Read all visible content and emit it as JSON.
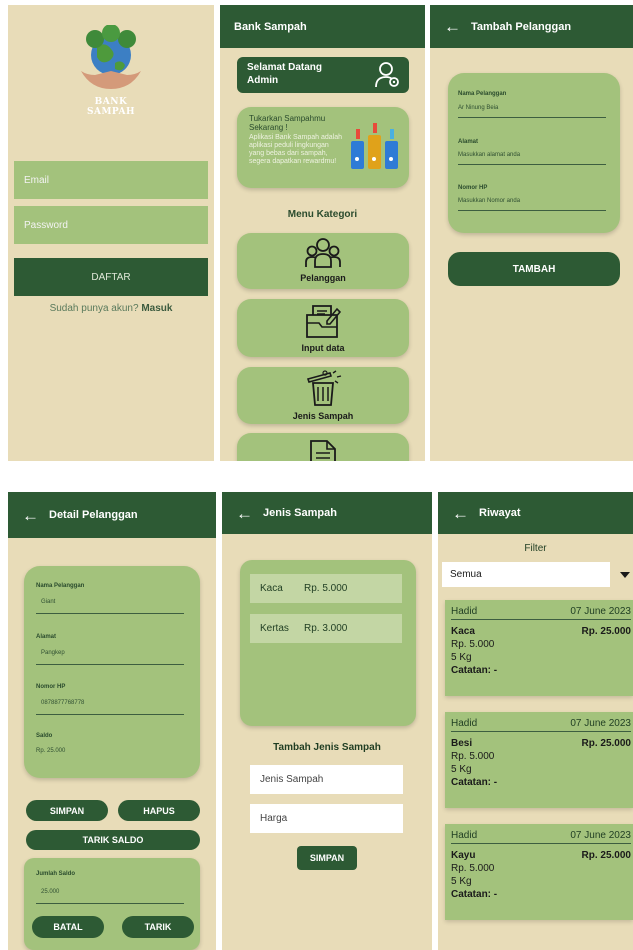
{
  "login": {
    "logo_text": "BANK SAMPAH",
    "email_placeholder": "Email",
    "password_placeholder": "Password",
    "button": "DAFTAR",
    "prompt": "Sudah punya akun?",
    "link": "Masuk"
  },
  "dashboard": {
    "appbar_title": "Bank Sampah",
    "welcome_line1": "Selamat Datang",
    "welcome_line2": "Admin",
    "promo_title": "Tukarkan Sampahmu Sekarang !",
    "promo_body": "Aplikasi Bank Sampah adalah aplikasi peduli lingkungan yang bebas dari sampah, segera dapatkan rewardmu!",
    "menu_heading": "Menu Kategori",
    "menu": [
      {
        "label": "Pelanggan",
        "icon": "users-icon"
      },
      {
        "label": "Input data",
        "icon": "input-folder-icon"
      },
      {
        "label": "Jenis Sampah",
        "icon": "trash-bin-icon"
      },
      {
        "label": "",
        "icon": "document-icon"
      }
    ]
  },
  "tambah": {
    "appbar_title": "Tambah Pelanggan",
    "fields": [
      {
        "label": "Nama Pelanggan",
        "value": "Ar Ninung Beia"
      },
      {
        "label": "Alamat",
        "value": "Masukkan alamat anda"
      },
      {
        "label": "Nomor HP",
        "value": "Masukkan Nomor anda"
      }
    ],
    "button": "TAMBAH"
  },
  "detail": {
    "appbar_title": "Detail Pelanggan",
    "fields": [
      {
        "label": "Nama Pelanggan",
        "value": "Giant"
      },
      {
        "label": "Alamat",
        "value": "Pangkep"
      },
      {
        "label": "Nomor HP",
        "value": "0878877768778"
      }
    ],
    "saldo_label": "Saldo",
    "saldo_value": "Rp. 25.000",
    "simpan": "SIMPAN",
    "hapus": "HAPUS",
    "tarik_saldo": "TARIK SALDO",
    "jumlah_label": "Jumlah Saldo",
    "jumlah_value": "25.000",
    "batal": "BATAL",
    "tarik": "TARIK"
  },
  "jenis": {
    "appbar_title": "Jenis Sampah",
    "items": [
      {
        "name": "Kaca",
        "price": "Rp. 5.000"
      },
      {
        "name": "Kertas",
        "price": "Rp. 3.000"
      }
    ],
    "form_heading": "Tambah Jenis Sampah",
    "name_placeholder": "Jenis Sampah",
    "price_placeholder": "Harga",
    "button": "SIMPAN"
  },
  "riwayat": {
    "appbar_title": "Riwayat",
    "filter_label": "Filter",
    "filter_value": "Semua",
    "entries": [
      {
        "user": "Hadid",
        "date": "07 June 2023",
        "item": "Kaca",
        "total": "Rp. 25.000",
        "price": "Rp. 5.000",
        "weight": "5 Kg",
        "note": "Catatan: -"
      },
      {
        "user": "Hadid",
        "date": "07 June 2023",
        "item": "Besi",
        "total": "Rp. 25.000",
        "price": "Rp. 5.000",
        "weight": "5 Kg",
        "note": "Catatan: -"
      },
      {
        "user": "Hadid",
        "date": "07 June 2023",
        "item": "Kayu",
        "total": "Rp. 25.000",
        "price": "Rp. 5.000",
        "weight": "5 Kg",
        "note": "Catatan: -"
      }
    ]
  },
  "colors": {
    "dark_green": "#2d5a34",
    "light_green": "#a3c27c",
    "cream": "#e8dcb8"
  }
}
